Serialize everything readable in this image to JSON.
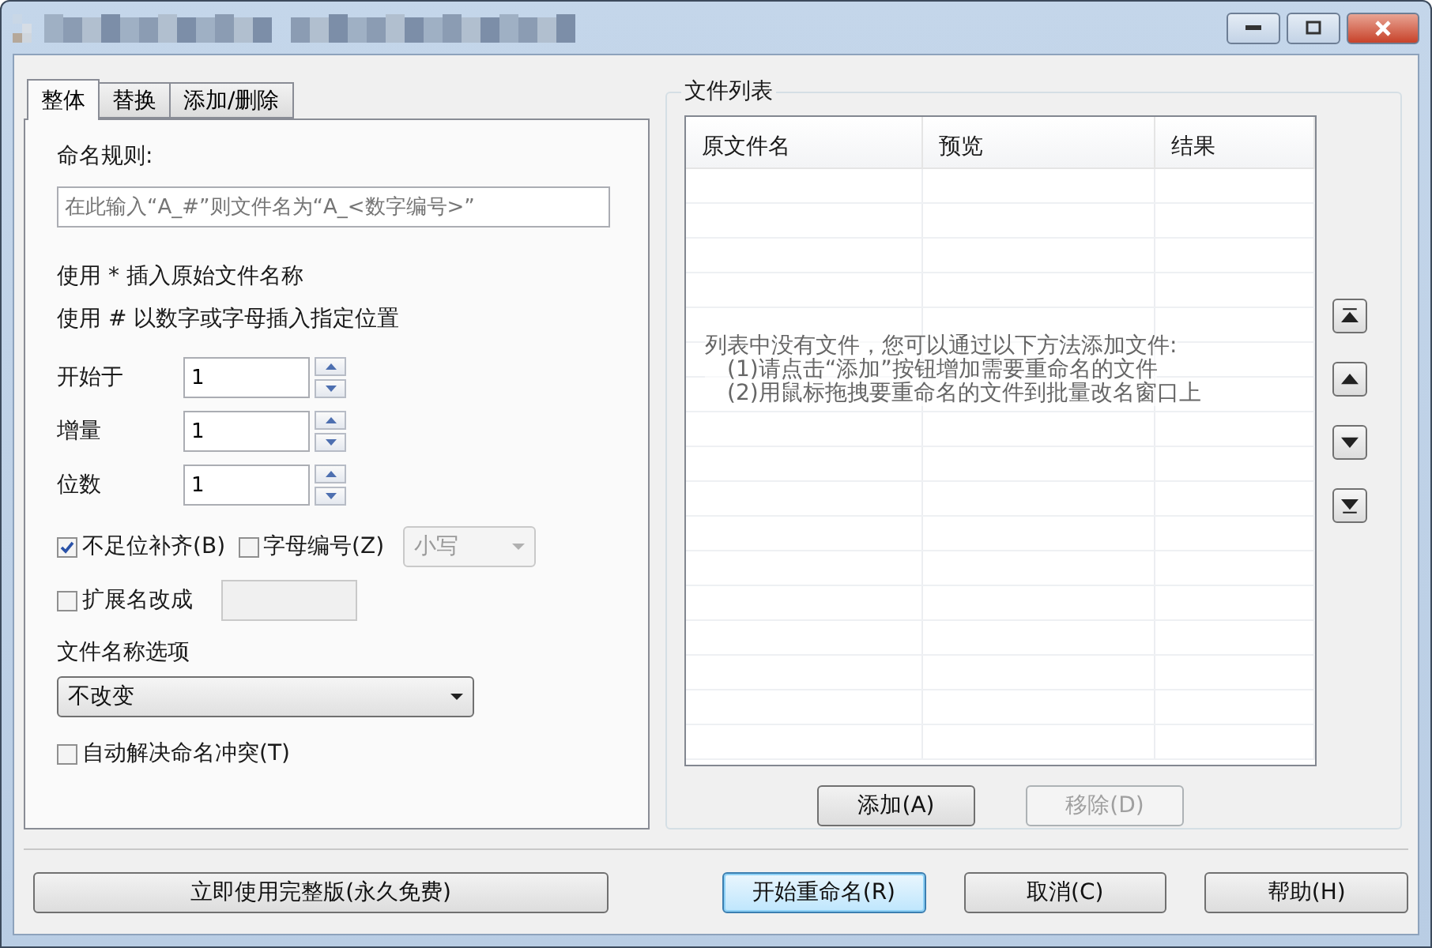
{
  "tabs": [
    {
      "label": "整体",
      "selected": true
    },
    {
      "label": "替换",
      "selected": false
    },
    {
      "label": "添加/删除",
      "selected": false
    }
  ],
  "naming_rule": {
    "label": "命名规则:",
    "placeholder": "在此输入“A_#”则文件名为“A_<数字编号>”"
  },
  "hints": [
    "使用 * 插入原始文件名称",
    "使用 # 以数字或字母插入指定位置"
  ],
  "spinners": [
    {
      "label": "开始于",
      "value": "1"
    },
    {
      "label": "增量",
      "value": "1"
    },
    {
      "label": "位数",
      "value": "1"
    }
  ],
  "pad_option": {
    "label": "不足位补齐(B)",
    "checked": true
  },
  "letter_option": {
    "label": "字母编号(Z)",
    "checked": false
  },
  "case_select": {
    "value": "小写",
    "disabled": true
  },
  "extension_option": {
    "label": "扩展名改成",
    "checked": false
  },
  "filename_option": {
    "label": "文件名称选项",
    "value": "不改变"
  },
  "auto_resolve": {
    "label": "自动解决命名冲突(T)",
    "checked": false
  },
  "file_list": {
    "title": "文件列表",
    "columns": [
      "原文件名",
      "预览",
      "结果"
    ],
    "empty_message": [
      "列表中没有文件，您可以通过以下方法添加文件:",
      "(1)请点击“添加”按钮增加需要重命名的文件",
      "(2)用鼠标拖拽要重命名的文件到批量改名窗口上"
    ],
    "buttons": [
      {
        "label": "添加(A)",
        "disabled": false
      },
      {
        "label": "移除(D)",
        "disabled": true
      }
    ]
  },
  "footer": {
    "upgrade": "立即使用完整版(永久免费)",
    "buttons": [
      {
        "label": "开始重命名(R)",
        "default": true
      },
      {
        "label": "取消(C)",
        "default": false
      },
      {
        "label": "帮助(H)",
        "default": false
      }
    ]
  }
}
